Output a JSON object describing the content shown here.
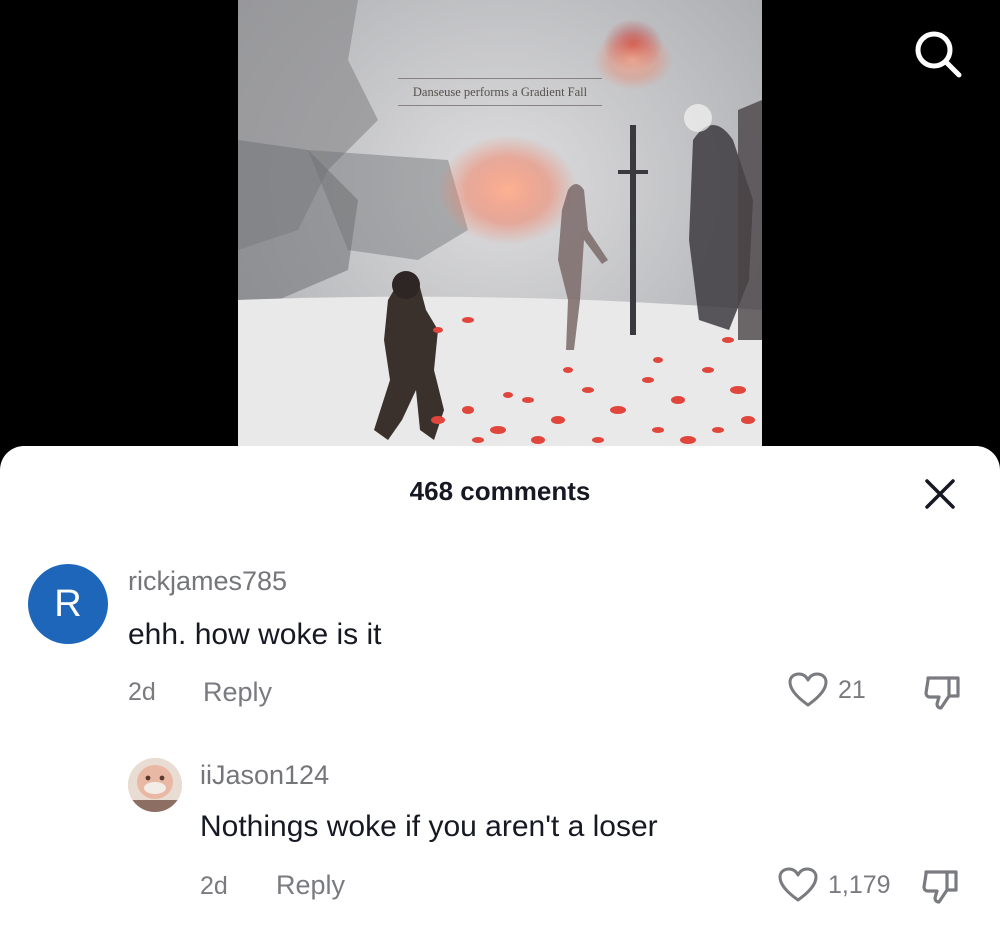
{
  "video": {
    "caption": "Danseuse performs a Gradient Fall",
    "search_icon": "search-icon"
  },
  "comments_sheet": {
    "title": "468 comments",
    "close_icon": "close-icon",
    "comments": [
      {
        "avatar_initial": "R",
        "avatar_color": "#1d66b9",
        "username": "rickjames785",
        "text": "ehh. how woke is it",
        "time": "2d",
        "reply_label": "Reply",
        "likes": "21"
      },
      {
        "avatar_initial": "",
        "username": "iiJason124",
        "text": "Nothings woke if you aren't a loser",
        "time": "2d",
        "reply_label": "Reply",
        "likes": "1,179"
      }
    ]
  }
}
